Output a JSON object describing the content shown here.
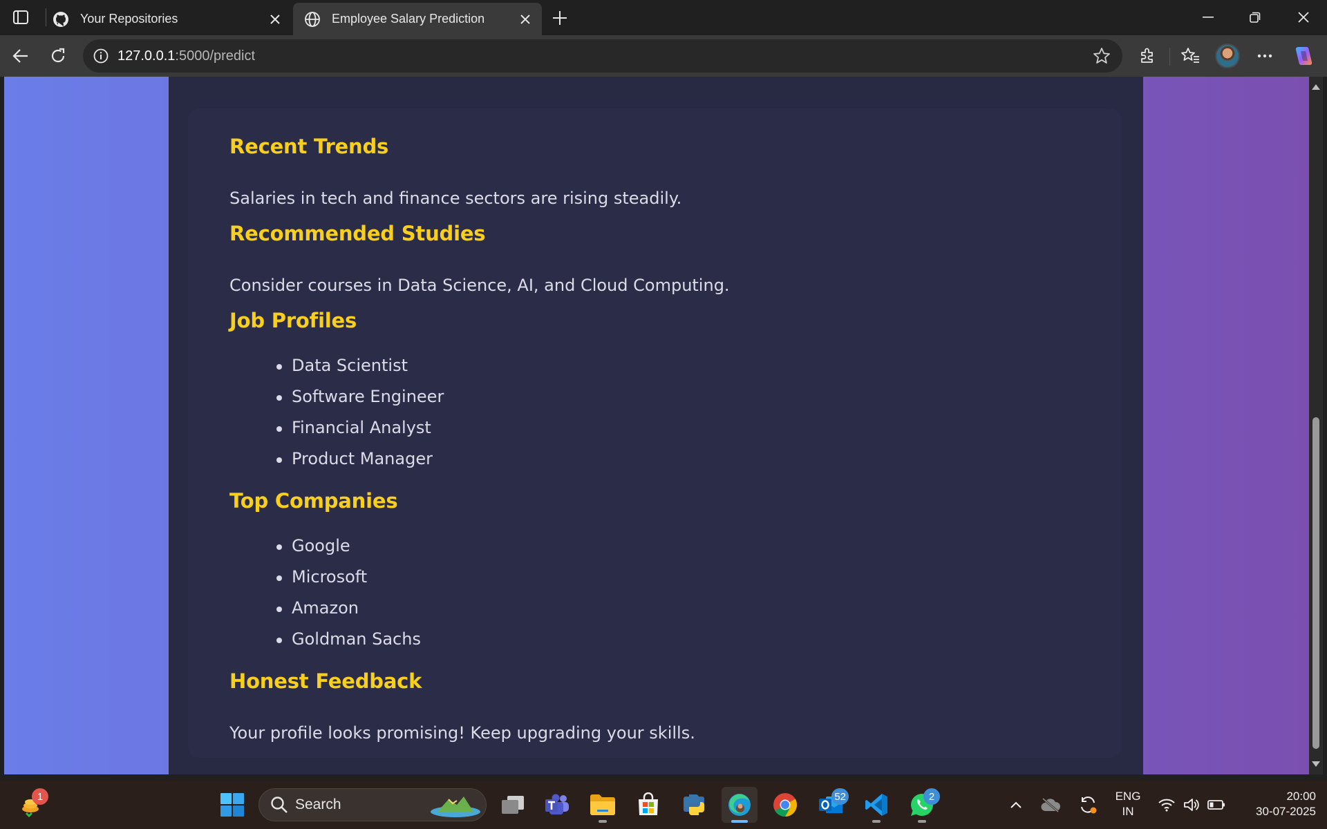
{
  "browser": {
    "tabs": [
      {
        "title": "Your Repositories",
        "favicon": "github-icon",
        "active": false
      },
      {
        "title": "Employee Salary Prediction",
        "favicon": "globe-icon",
        "active": true
      }
    ],
    "url_host": "127.0.0.1",
    "url_path": ":5000/predict"
  },
  "page": {
    "sections": {
      "recent_trends": {
        "title": "Recent Trends",
        "text": "Salaries in tech and finance sectors are rising steadily."
      },
      "recommended_studies": {
        "title": "Recommended Studies",
        "text": "Consider courses in Data Science, AI, and Cloud Computing."
      },
      "job_profiles": {
        "title": "Job Profiles",
        "items": [
          "Data Scientist",
          "Software Engineer",
          "Financial Analyst",
          "Product Manager"
        ]
      },
      "top_companies": {
        "title": "Top Companies",
        "items": [
          "Google",
          "Microsoft",
          "Amazon",
          "Goldman Sachs"
        ]
      },
      "honest_feedback": {
        "title": "Honest Feedback",
        "text": "Your profile looks promising! Keep upgrading your skills."
      }
    },
    "colors": {
      "heading": "#f8cf1c",
      "text": "#dcdce8",
      "panel": "#282a44"
    }
  },
  "taskbar": {
    "search_label": "Search",
    "widgets_badge": "1",
    "outlook_badge": "52",
    "whatsapp_badge": "2",
    "language": "ENG",
    "region": "IN",
    "time": "20:00",
    "date": "30-07-2025"
  }
}
